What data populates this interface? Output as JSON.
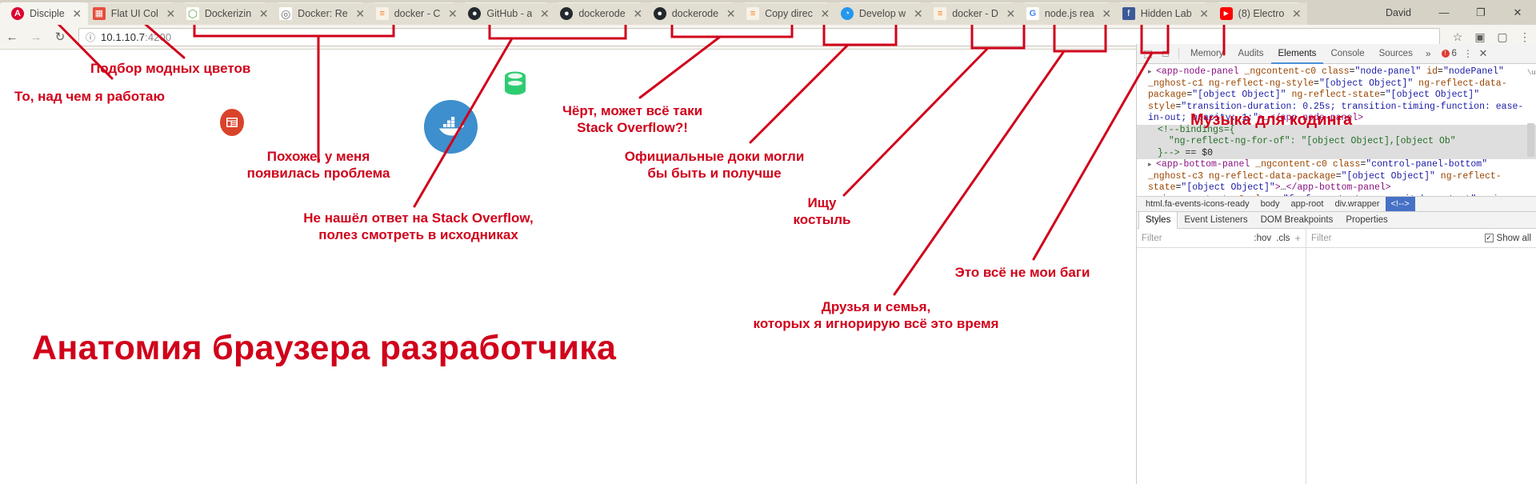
{
  "browser": {
    "tabs": [
      {
        "title": "Disciple",
        "favicon": "angular-icon",
        "color": "#dd0031",
        "glyph": "A",
        "active": true
      },
      {
        "title": "Flat UI Col",
        "favicon": "flatui-icon",
        "color": "#e74c3c",
        "glyph": "▦",
        "active": false
      },
      {
        "title": "Dockerizin",
        "favicon": "hexagon-icon",
        "color": "#6aa84f",
        "glyph": "⬡",
        "active": false
      },
      {
        "title": "Docker: Re",
        "favicon": "globe-icon",
        "color": "#6d6d6d",
        "glyph": "◎",
        "active": false
      },
      {
        "title": "docker - C",
        "favicon": "stackoverflow-icon",
        "color": "#f48024",
        "glyph": "≡",
        "active": false
      },
      {
        "title": "GitHub - a",
        "favicon": "github-icon",
        "color": "#24292e",
        "glyph": "●",
        "active": false
      },
      {
        "title": "dockerode",
        "favicon": "github-icon",
        "color": "#24292e",
        "glyph": "●",
        "active": false
      },
      {
        "title": "dockerode",
        "favicon": "github-icon",
        "color": "#24292e",
        "glyph": "●",
        "active": false
      },
      {
        "title": "Copy direc",
        "favicon": "stackoverflow-icon",
        "color": "#f48024",
        "glyph": "≡",
        "active": false
      },
      {
        "title": "Develop w",
        "favicon": "docker-icon",
        "color": "#2496ed",
        "glyph": "◔",
        "active": false
      },
      {
        "title": "docker - D",
        "favicon": "stackoverflow-icon",
        "color": "#f48024",
        "glyph": "≡",
        "active": false
      },
      {
        "title": "node.js rea",
        "favicon": "google-icon",
        "color": "#4285f4",
        "glyph": "G",
        "active": false
      },
      {
        "title": "Hidden Lab",
        "favicon": "facebook-icon",
        "color": "#3b5998",
        "glyph": "f",
        "active": false
      },
      {
        "title": "(8) Electro",
        "favicon": "youtube-icon",
        "color": "#ff0000",
        "glyph": "▶",
        "active": false
      }
    ],
    "new_tab_label": "+",
    "window": {
      "user": "David",
      "minimize": "—",
      "maximize": "❐",
      "close": "✕"
    },
    "toolbar": {
      "back": "←",
      "forward": "→",
      "reload": "↻",
      "info_icon": "ⓘ",
      "url": "10.1.10.7:4200",
      "url_host": "10.1.10.7",
      "url_port": ":4200",
      "star": "☆",
      "camera": "▣",
      "cast": "▢",
      "menu": "⋮"
    }
  },
  "page": {
    "icons": [
      {
        "name": "red-app-icon",
        "glyph": "▤"
      },
      {
        "name": "docker-whale-icon",
        "glyph": "⛴"
      },
      {
        "name": "database-icon",
        "glyph": "⛁"
      }
    ]
  },
  "devtools": {
    "inspect_icon": "⬚",
    "device_icon": "□",
    "tabs": [
      "Memory",
      "Audits",
      "Elements",
      "Console",
      "Sources"
    ],
    "active_tab": "Elements",
    "more_tabs": "»",
    "error_count": "6",
    "kebab": "⋮",
    "close": "✕",
    "dom_lines": [
      {
        "indent": 0,
        "arrow": "▸",
        "parts": [
          {
            "c": "tg",
            "t": "<app-node-panel"
          },
          {
            "c": "at",
            "t": " _ngcontent-c0"
          },
          {
            "c": "at",
            "t": " class"
          },
          {
            "c": "pn",
            "t": "="
          },
          {
            "c": "av",
            "t": "\"node-panel\""
          },
          {
            "c": "at",
            "t": " id"
          },
          {
            "c": "pn",
            "t": "="
          },
          {
            "c": "av",
            "t": "\"nodePanel\""
          },
          {
            "c": "at",
            "t": " _nghost-c1"
          },
          {
            "c": "at",
            "t": " ng-reflect-ng-style"
          },
          {
            "c": "pn",
            "t": "="
          },
          {
            "c": "av",
            "t": "\"[object Object]\""
          },
          {
            "c": "at",
            "t": " ng-reflect-data-package"
          },
          {
            "c": "pn",
            "t": "="
          },
          {
            "c": "av",
            "t": "\"[object Object]\""
          },
          {
            "c": "at",
            "t": " ng-reflect-state"
          },
          {
            "c": "pn",
            "t": "="
          },
          {
            "c": "av",
            "t": "\"[object Object]\""
          },
          {
            "c": "at",
            "t": " style"
          },
          {
            "c": "pn",
            "t": "="
          },
          {
            "c": "av",
            "t": "\"transition-duration: 0.25s; transition-timing-function: ease-in-out; opacity: 1;\""
          },
          {
            "c": "tg",
            "t": ">"
          },
          {
            "c": "pn",
            "t": "…"
          },
          {
            "c": "tg",
            "t": "</app-node-panel>"
          }
        ]
      },
      {
        "indent": 1,
        "arrow": "",
        "selected": true,
        "parts": [
          {
            "c": "cm",
            "t": "<!--bindings={"
          }
        ]
      },
      {
        "indent": 1,
        "arrow": "",
        "selected": true,
        "parts": [
          {
            "c": "cm",
            "t": "  \"ng-reflect-ng-for-of\": \"[object Object],[object Ob\""
          }
        ]
      },
      {
        "indent": 1,
        "arrow": "",
        "selected": true,
        "parts": [
          {
            "c": "cm",
            "t": "}-->"
          },
          {
            "c": "pn",
            "t": " == $0"
          }
        ]
      },
      {
        "indent": 0,
        "arrow": "▸",
        "parts": [
          {
            "c": "tg",
            "t": "<app-bottom-panel"
          },
          {
            "c": "at",
            "t": " _ngcontent-c0"
          },
          {
            "c": "at",
            "t": " class"
          },
          {
            "c": "pn",
            "t": "="
          },
          {
            "c": "av",
            "t": "\"control-panel-bottom\""
          },
          {
            "c": "at",
            "t": " _nghost-c3"
          },
          {
            "c": "at",
            "t": " ng-reflect-data-package"
          },
          {
            "c": "pn",
            "t": "="
          },
          {
            "c": "av",
            "t": "\"[object Object]\""
          },
          {
            "c": "at",
            "t": " ng-reflect-state"
          },
          {
            "c": "pn",
            "t": "="
          },
          {
            "c": "av",
            "t": "\"[object Object]\""
          },
          {
            "c": "tg",
            "t": ">"
          },
          {
            "c": "pn",
            "t": "…"
          },
          {
            "c": "tg",
            "t": "</app-bottom-panel>"
          }
        ]
      },
      {
        "indent": 0,
        "arrow": "▸",
        "parts": [
          {
            "c": "tg",
            "t": "<i"
          },
          {
            "c": "at",
            "t": " _ngcontent-c0"
          },
          {
            "c": "at",
            "t": " class"
          },
          {
            "c": "pn",
            "t": "="
          },
          {
            "c": "av",
            "t": "\"fa fa-content-copy switch-context\""
          },
          {
            "c": "at",
            "t": " aria-hidden"
          },
          {
            "c": "pn",
            "t": "="
          },
          {
            "c": "av",
            "t": "\"true\""
          },
          {
            "c": "tg",
            "t": ">"
          },
          {
            "c": "pn",
            "t": "…"
          },
          {
            "c": "tg",
            "t": "</i>"
          }
        ]
      }
    ],
    "breadcrumbs": [
      "html.fa-events-icons-ready",
      "body",
      "app-root",
      "div.wrapper",
      "<!-->"
    ],
    "active_breadcrumb": "<!-->",
    "subtabs": [
      "Styles",
      "Event Listeners",
      "DOM Breakpoints",
      "Properties"
    ],
    "active_subtab": "Styles",
    "filter_placeholder": "Filter",
    "hov_label": ":hov",
    "cls_label": ".cls",
    "plus_label": "+",
    "computed_filter_placeholder": "Filter",
    "show_all_label": "Show all",
    "show_all_checked": "✓"
  },
  "annotations": {
    "accent_color": "#d0021b",
    "title": "Анатомия браузера разработчика",
    "music_label": "Музыка для кодинга",
    "labels": [
      {
        "id": "working-on",
        "text": "То, над чем я работаю"
      },
      {
        "id": "trendy-colors",
        "text": "Подбор модных цветов"
      },
      {
        "id": "got-a-problem",
        "text": "Похоже, у меня\nпоявилась проблема"
      },
      {
        "id": "no-answer-so",
        "text": "Не нашёл ответ на Stack Overflow,\nполез смотреть в исходниках"
      },
      {
        "id": "maybe-so",
        "text": "Чёрт, может всё таки\nStack Overflow?!"
      },
      {
        "id": "official-docs",
        "text": "Официальные доки могли\nбы быть и получше"
      },
      {
        "id": "looking-crutch",
        "text": "Ищу костыль"
      },
      {
        "id": "friends-family",
        "text": "Друзья и семья,\nкоторых я игнорирую всё это время"
      },
      {
        "id": "not-my-bugs",
        "text": "Это всё не мои баги"
      }
    ]
  }
}
